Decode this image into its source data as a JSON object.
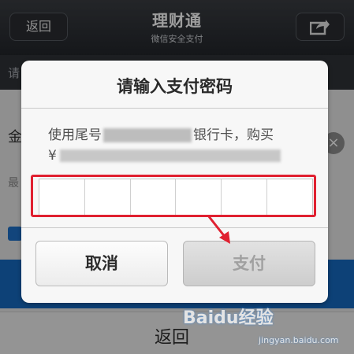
{
  "header": {
    "back_label": "返回",
    "title": "理财通",
    "subtitle": "微信安全支付"
  },
  "second_bar": {
    "partial_text": "请"
  },
  "background": {
    "amount_label": "金",
    "hint_label": "最",
    "bottom_back_label": "返回"
  },
  "dialog": {
    "title": "请输入支付密码",
    "desc_line1_prefix": "使用尾号",
    "desc_line1_suffix": "银行卡，购买",
    "desc_line2_prefix": "¥",
    "password_cells": 6,
    "cancel_label": "取消",
    "pay_label": "支付"
  },
  "watermark": {
    "text": "Baidu经验",
    "url": "jingyan.baidu.com"
  },
  "icons": {
    "share": "share-icon",
    "close": "close-icon",
    "arrow": "red-arrow-icon"
  },
  "colors": {
    "highlight": "#e02030",
    "brand_blue": "#1569c0"
  }
}
